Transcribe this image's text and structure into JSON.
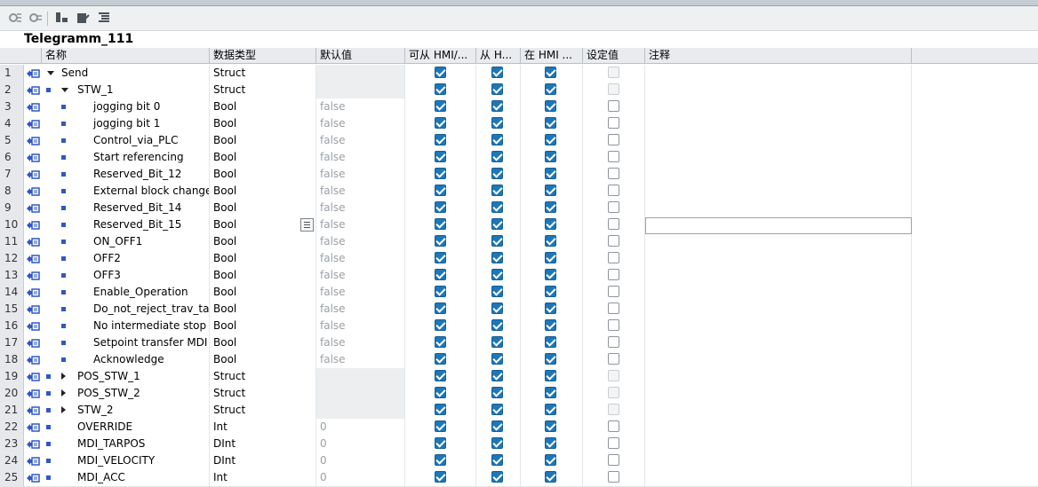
{
  "title": "Telegramm_111",
  "toolbar": {
    "icons": [
      "expand-icon",
      "collapse-icon",
      "insert-row-icon",
      "edit-icon",
      "list-icon"
    ]
  },
  "headers": {
    "name": "名称",
    "datatype": "数据类型",
    "default": "默认值",
    "hmi_access": "可从 HMI/...",
    "hmi_write": "从 H...",
    "hmi_visible": "在 HMI ...",
    "setpoint": "设定值",
    "comment": "注释"
  },
  "colors": {
    "accent": "#1d77b9",
    "rowheader": "#e6e8eb",
    "icon": "#2f57c8"
  },
  "rows": [
    {
      "num": "1",
      "name": "Send",
      "type": "Struct",
      "default": "",
      "level": 0,
      "marker": "down",
      "a": true,
      "b": true,
      "c": true,
      "sp": "dis"
    },
    {
      "num": "2",
      "name": "STW_1",
      "type": "Struct",
      "default": "",
      "level": 1,
      "marker": "down",
      "a": true,
      "b": true,
      "c": true,
      "sp": "dis"
    },
    {
      "num": "3",
      "name": "jogging bit 0",
      "type": "Bool",
      "default": "false",
      "level": 2,
      "marker": "sq",
      "a": true,
      "b": true,
      "c": true,
      "sp": "off"
    },
    {
      "num": "4",
      "name": "jogging bit 1",
      "type": "Bool",
      "default": "false",
      "level": 2,
      "marker": "sq",
      "a": true,
      "b": true,
      "c": true,
      "sp": "off"
    },
    {
      "num": "5",
      "name": "Control_via_PLC",
      "type": "Bool",
      "default": "false",
      "level": 2,
      "marker": "sq",
      "a": true,
      "b": true,
      "c": true,
      "sp": "off"
    },
    {
      "num": "6",
      "name": "Start referencing",
      "type": "Bool",
      "default": "false",
      "level": 2,
      "marker": "sq",
      "a": true,
      "b": true,
      "c": true,
      "sp": "off"
    },
    {
      "num": "7",
      "name": "Reserved_Bit_12",
      "type": "Bool",
      "default": "false",
      "level": 2,
      "marker": "sq",
      "a": true,
      "b": true,
      "c": true,
      "sp": "off"
    },
    {
      "num": "8",
      "name": "External block change",
      "type": "Bool",
      "default": "false",
      "level": 2,
      "marker": "sq",
      "a": true,
      "b": true,
      "c": true,
      "sp": "off"
    },
    {
      "num": "9",
      "name": "Reserved_Bit_14",
      "type": "Bool",
      "default": "false",
      "level": 2,
      "marker": "sq",
      "a": true,
      "b": true,
      "c": true,
      "sp": "off"
    },
    {
      "num": "10",
      "name": "Reserved_Bit_15",
      "type": "Bool",
      "default": "false",
      "level": 2,
      "marker": "sq",
      "a": true,
      "b": true,
      "c": true,
      "sp": "off"
    },
    {
      "num": "11",
      "name": "ON_OFF1",
      "type": "Bool",
      "default": "false",
      "level": 2,
      "marker": "sq",
      "a": true,
      "b": true,
      "c": true,
      "sp": "off"
    },
    {
      "num": "12",
      "name": "OFF2",
      "type": "Bool",
      "default": "false",
      "level": 2,
      "marker": "sq",
      "a": true,
      "b": true,
      "c": true,
      "sp": "off"
    },
    {
      "num": "13",
      "name": "OFF3",
      "type": "Bool",
      "default": "false",
      "level": 2,
      "marker": "sq",
      "a": true,
      "b": true,
      "c": true,
      "sp": "off"
    },
    {
      "num": "14",
      "name": "Enable_Operation",
      "type": "Bool",
      "default": "false",
      "level": 2,
      "marker": "sq",
      "a": true,
      "b": true,
      "c": true,
      "sp": "off"
    },
    {
      "num": "15",
      "name": "Do_not_reject_trav_task",
      "type": "Bool",
      "default": "false",
      "level": 2,
      "marker": "sq",
      "a": true,
      "b": true,
      "c": true,
      "sp": "off"
    },
    {
      "num": "16",
      "name": "No intermediate stop",
      "type": "Bool",
      "default": "false",
      "level": 2,
      "marker": "sq",
      "a": true,
      "b": true,
      "c": true,
      "sp": "off"
    },
    {
      "num": "17",
      "name": "Setpoint transfer MDI",
      "type": "Bool",
      "default": "false",
      "level": 2,
      "marker": "sq",
      "a": true,
      "b": true,
      "c": true,
      "sp": "off"
    },
    {
      "num": "18",
      "name": "Acknowledge",
      "type": "Bool",
      "default": "false",
      "level": 2,
      "marker": "sq",
      "a": true,
      "b": true,
      "c": true,
      "sp": "off"
    },
    {
      "num": "19",
      "name": "POS_STW_1",
      "type": "Struct",
      "default": "",
      "level": 1,
      "marker": "right",
      "a": true,
      "b": true,
      "c": true,
      "sp": "dis"
    },
    {
      "num": "20",
      "name": "POS_STW_2",
      "type": "Struct",
      "default": "",
      "level": 1,
      "marker": "right",
      "a": true,
      "b": true,
      "c": true,
      "sp": "dis"
    },
    {
      "num": "21",
      "name": "STW_2",
      "type": "Struct",
      "default": "",
      "level": 1,
      "marker": "right",
      "a": true,
      "b": true,
      "c": true,
      "sp": "dis"
    },
    {
      "num": "22",
      "name": "OVERRIDE",
      "type": "Int",
      "default": "0",
      "level": 1,
      "marker": "none",
      "a": true,
      "b": true,
      "c": true,
      "sp": "off"
    },
    {
      "num": "23",
      "name": "MDI_TARPOS",
      "type": "DInt",
      "default": "0",
      "level": 1,
      "marker": "none",
      "a": true,
      "b": true,
      "c": true,
      "sp": "off"
    },
    {
      "num": "24",
      "name": "MDI_VELOCITY",
      "type": "DInt",
      "default": "0",
      "level": 1,
      "marker": "none",
      "a": true,
      "b": true,
      "c": true,
      "sp": "off"
    },
    {
      "num": "25",
      "name": "MDI_ACC",
      "type": "Int",
      "default": "0",
      "level": 1,
      "marker": "none",
      "a": true,
      "b": true,
      "c": true,
      "sp": "off"
    }
  ]
}
